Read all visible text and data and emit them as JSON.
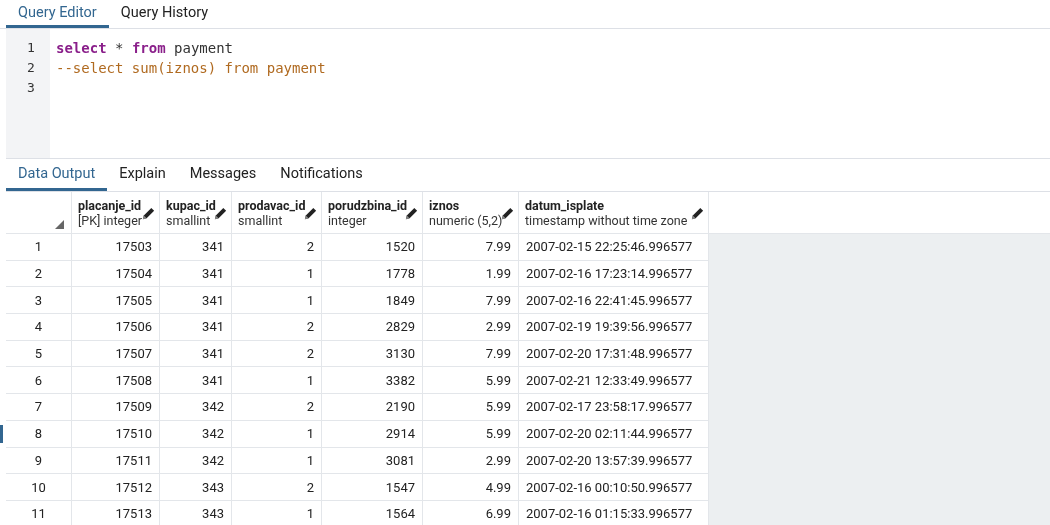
{
  "editor_tabs": [
    {
      "label": "Query Editor",
      "selected": true
    },
    {
      "label": "Query History",
      "selected": false
    }
  ],
  "editor": {
    "lines": [
      {
        "number": "1",
        "tokens": [
          {
            "kind": "keyword",
            "text": "select"
          },
          {
            "kind": "plain",
            "text": " * "
          },
          {
            "kind": "keyword",
            "text": "from"
          },
          {
            "kind": "plain",
            "text": " payment"
          }
        ]
      },
      {
        "number": "2",
        "tokens": [
          {
            "kind": "comment",
            "text": "--select sum(iznos) from payment"
          }
        ]
      },
      {
        "number": "3"
      }
    ]
  },
  "result_tabs": [
    {
      "label": "Data Output",
      "selected": true
    },
    {
      "label": "Explain",
      "selected": false
    },
    {
      "label": "Messages",
      "selected": false
    },
    {
      "label": "Notifications",
      "selected": false
    }
  ],
  "table": {
    "columns": [
      {
        "name": "placanje_id",
        "type": "[PK] integer"
      },
      {
        "name": "kupac_id",
        "type": "smallint"
      },
      {
        "name": "prodavac_id",
        "type": "smallint"
      },
      {
        "name": "porudzbina_id",
        "type": "integer"
      },
      {
        "name": "iznos",
        "type": "numeric (5,2)"
      },
      {
        "name": "datum_isplate",
        "type": "timestamp without time zone"
      }
    ],
    "rows": [
      {
        "number": "1",
        "focused": false,
        "cells": [
          "17503",
          "341",
          "2",
          "1520",
          "7.99",
          "2007-02-15 22:25:46.996577"
        ]
      },
      {
        "number": "2",
        "focused": false,
        "cells": [
          "17504",
          "341",
          "1",
          "1778",
          "1.99",
          "2007-02-16 17:23:14.996577"
        ]
      },
      {
        "number": "3",
        "focused": false,
        "cells": [
          "17505",
          "341",
          "1",
          "1849",
          "7.99",
          "2007-02-16 22:41:45.996577"
        ]
      },
      {
        "number": "4",
        "focused": false,
        "cells": [
          "17506",
          "341",
          "2",
          "2829",
          "2.99",
          "2007-02-19 19:39:56.996577"
        ]
      },
      {
        "number": "5",
        "focused": false,
        "cells": [
          "17507",
          "341",
          "2",
          "3130",
          "7.99",
          "2007-02-20 17:31:48.996577"
        ]
      },
      {
        "number": "6",
        "focused": false,
        "cells": [
          "17508",
          "341",
          "1",
          "3382",
          "5.99",
          "2007-02-21 12:33:49.996577"
        ]
      },
      {
        "number": "7",
        "focused": false,
        "cells": [
          "17509",
          "342",
          "2",
          "2190",
          "5.99",
          "2007-02-17 23:58:17.996577"
        ]
      },
      {
        "number": "8",
        "focused": true,
        "cells": [
          "17510",
          "342",
          "1",
          "2914",
          "5.99",
          "2007-02-20 02:11:44.996577"
        ]
      },
      {
        "number": "9",
        "focused": false,
        "cells": [
          "17511",
          "342",
          "1",
          "3081",
          "2.99",
          "2007-02-20 13:57:39.996577"
        ]
      },
      {
        "number": "10",
        "focused": false,
        "cells": [
          "17512",
          "343",
          "2",
          "1547",
          "4.99",
          "2007-02-16 00:10:50.996577"
        ]
      },
      {
        "number": "11",
        "focused": false,
        "cells": [
          "17513",
          "343",
          "1",
          "1564",
          "6.99",
          "2007-02-16 01:15:33.996577"
        ]
      }
    ]
  }
}
